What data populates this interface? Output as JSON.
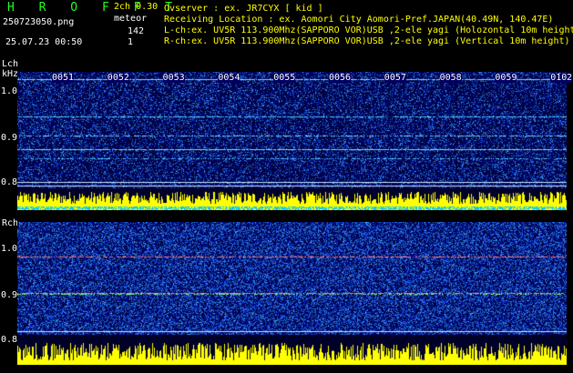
{
  "header": {
    "app_title": "H R O F F T",
    "version": "2ch 0.30",
    "filename": "250723050.png",
    "datetime": "25.07.23 00:50",
    "meteor_label": "meteor",
    "lch_count": "142",
    "rch_count": "1",
    "observer": "Ovserver           : ex. JR7CYX [ kid ]",
    "location": "Receiving Location : ex. Aomori City Aomori-Pref.JAPAN(40.49N, 140.47E)",
    "lch_info": "L-ch:ex. UV5R 113.900Mhz(SAPPORO VOR)USB ,2-ele yagi (Holozontal 10m height)",
    "rch_info": "R-ch:ex. UV5R 113.900Mhz(SAPPORO VOR)USB ,2-ele yagi (Vertical 10m height)"
  },
  "lch_panel": {
    "label": "Lch",
    "unit": "kHz",
    "ticks": [
      "1.0",
      "0.9",
      "0.8"
    ]
  },
  "rch_panel": {
    "label": "Rch",
    "ticks": [
      "1.0",
      "0.9",
      "0.8"
    ]
  },
  "time_labels": [
    "0051",
    "0052",
    "0053",
    "0054",
    "0055",
    "0056",
    "0057",
    "0058",
    "0059",
    "0100",
    "2"
  ],
  "colors": {
    "app_title": "#22ff22",
    "info_text": "#ffff00",
    "background_low": "#000060",
    "signal_high": "#00ffff",
    "bar_yellow": "#ffff00"
  }
}
